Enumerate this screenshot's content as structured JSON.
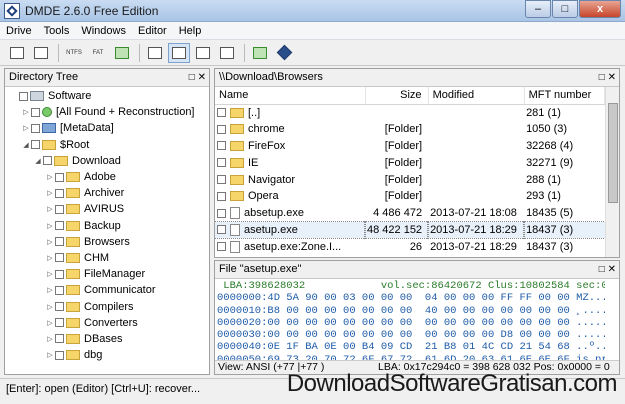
{
  "window": {
    "title": "DMDE 2.6.0 Free Edition",
    "minimize": "–",
    "maximize": "□",
    "close": "x"
  },
  "menu": [
    "Drive",
    "Tools",
    "Windows",
    "Editor",
    "Help"
  ],
  "toolbar": {
    "ntfs_label": "NTFS",
    "fat_label": "FAT"
  },
  "directory_tree": {
    "title": "Directory Tree",
    "items": [
      {
        "label": "Software",
        "level": 0,
        "icon": "drive-icon"
      },
      {
        "label": "[All Found + Reconstruction]",
        "level": 1,
        "icon": "found-icon"
      },
      {
        "label": "[MetaData]",
        "level": 1,
        "icon": "metadata-folder-icon"
      },
      {
        "label": "$Root",
        "level": 1,
        "icon": "folder-icon"
      },
      {
        "label": "Download",
        "level": 2,
        "icon": "folder-icon"
      },
      {
        "label": "Adobe",
        "level": 3,
        "icon": "folder-icon"
      },
      {
        "label": "Archiver",
        "level": 3,
        "icon": "folder-icon"
      },
      {
        "label": "AVIRUS",
        "level": 3,
        "icon": "folder-icon"
      },
      {
        "label": "Backup",
        "level": 3,
        "icon": "folder-icon"
      },
      {
        "label": "Browsers",
        "level": 3,
        "icon": "folder-icon"
      },
      {
        "label": "CHM",
        "level": 3,
        "icon": "folder-icon"
      },
      {
        "label": "FileManager",
        "level": 3,
        "icon": "folder-icon"
      },
      {
        "label": "Communicator",
        "level": 3,
        "icon": "folder-icon"
      },
      {
        "label": "Compilers",
        "level": 3,
        "icon": "folder-icon"
      },
      {
        "label": "Converters",
        "level": 3,
        "icon": "folder-icon"
      },
      {
        "label": "DBases",
        "level": 3,
        "icon": "folder-icon"
      },
      {
        "label": "dbg",
        "level": 3,
        "icon": "folder-icon"
      }
    ]
  },
  "file_list": {
    "path": "\\\\Download\\Browsers",
    "columns": [
      "Name",
      "Size",
      "Modified",
      "MFT number"
    ],
    "rows": [
      {
        "name": "[..]",
        "size": "",
        "modified": "",
        "mft": "281 (1)",
        "icon": "up-folder-icon"
      },
      {
        "name": "chrome",
        "size": "[Folder]",
        "modified": "",
        "mft": "1050 (3)",
        "icon": "folder-icon"
      },
      {
        "name": "FireFox",
        "size": "[Folder]",
        "modified": "",
        "mft": "32268 (4)",
        "icon": "folder-icon"
      },
      {
        "name": "IE",
        "size": "[Folder]",
        "modified": "",
        "mft": "32271 (9)",
        "icon": "folder-icon"
      },
      {
        "name": "Navigator",
        "size": "[Folder]",
        "modified": "",
        "mft": "288 (1)",
        "icon": "folder-icon"
      },
      {
        "name": "Opera",
        "size": "[Folder]",
        "modified": "",
        "mft": "293 (1)",
        "icon": "folder-icon"
      },
      {
        "name": "absetup.exe",
        "size": "4 486 472",
        "modified": "2013-07-21 18:08",
        "mft": "18435 (5)",
        "icon": "file-icon"
      },
      {
        "name": "asetup.exe",
        "size": "48 422 152",
        "modified": "2013-07-21 18:29",
        "mft": "18437 (3)",
        "icon": "file-icon",
        "selected": true
      },
      {
        "name": "asetup.exe:Zone.I...",
        "size": "26",
        "modified": "2013-07-21 18:29",
        "mft": "18437 (3)",
        "icon": "file-icon"
      }
    ]
  },
  "hex_view": {
    "title": "File \"asetup.exe\"",
    "info": " LBA:398628032            vol.sec:86420672 Clus:10802584 sec:0",
    "lines": [
      "0000000:4D 5A 90 00 03 00 00 00  04 00 00 00 FF FF 00 00 MZ.....",
      "0000010:B8 00 00 00 00 00 00 00  40 00 00 00 00 00 00 00 ¸.......",
      "0000020:00 00 00 00 00 00 00 00  00 00 00 00 00 00 00 00 ........",
      "0000030:00 00 00 00 00 00 00 00  00 00 00 00 D8 00 00 00 ........",
      "0000040:0E 1F BA 0E 00 B4 09 CD  21 B8 01 4C CD 21 54 68 ..º..´.Í",
      "0000050:69 73 20 70 72 6F 67 72  61 6D 20 63 61 6E 6E 6F is prog"
    ],
    "footer_left": "View: ANSI (+77 |+77 )",
    "footer_right": "LBA: 0x17c294c0 = 398 628 032 Pos: 0x0000 = 0"
  },
  "statusbar": {
    "text": "[Enter]: open (Editor)  [Ctrl+U]: recover..."
  },
  "watermark": "DownloadSoftwareGratisan.com"
}
